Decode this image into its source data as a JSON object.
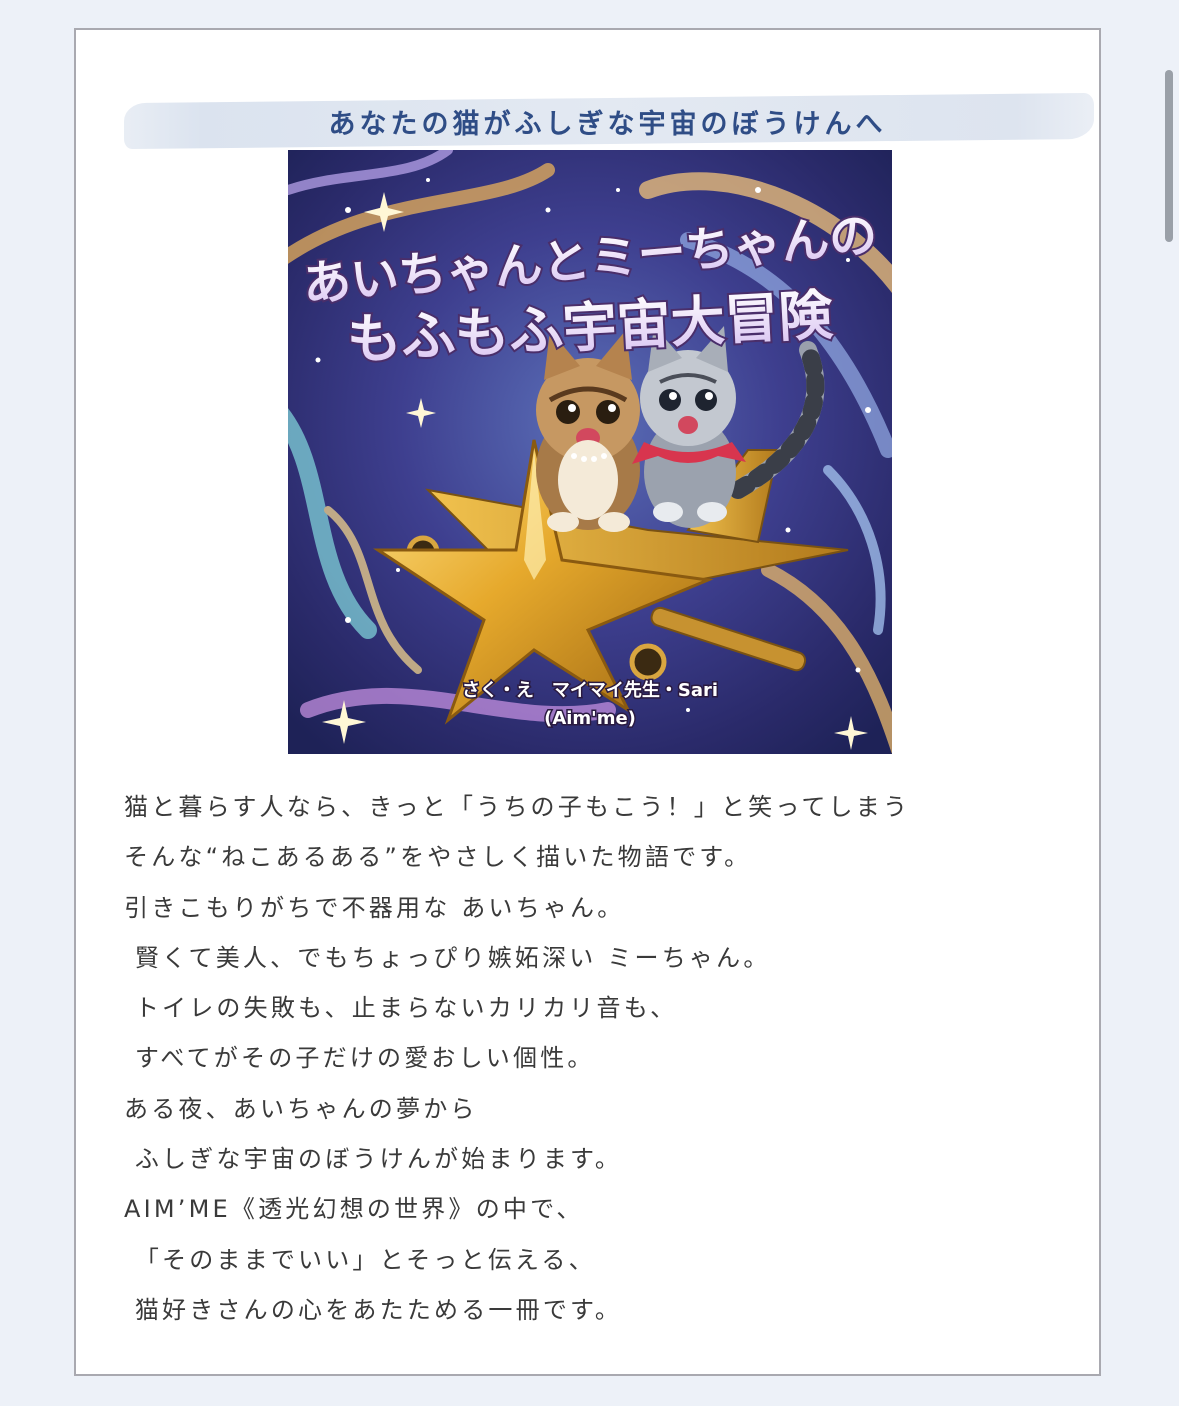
{
  "heading": "あなたの猫がふしぎな宇宙のぼうけんへ",
  "cover": {
    "title_line1": "あいちゃんとミーちゃんの",
    "title_line2": "もふもふ宇宙大冒険",
    "credit_line1": "さく・え　マイマイ先生・Sari",
    "credit_line2": "(Aim'me)"
  },
  "description": [
    "猫と暮らす人なら、きっと「うちの子もこう！」と笑ってしまう",
    "そんな“ねこあるある”をやさしく描いた物語です。",
    "引きこもりがちで不器用な あいちゃん。",
    " 賢くて美人、でもちょっぴり嫉妬深い ミーちゃん。",
    " トイレの失敗も、止まらないカリカリ音も、",
    " すべてがその子だけの愛おしい個性。",
    "ある夜、あいちゃんの夢から",
    " ふしぎな宇宙のぼうけんが始まります。",
    "AIM’ME《透光幻想の世界》の中で、",
    " 「そのままでいい」とそっと伝える、",
    " 猫好きさんの心をあたためる一冊です。"
  ],
  "colors": {
    "heading": "#2f4d86",
    "body_text": "#3a3a3a",
    "page_bg": "#edf1f8",
    "card_border": "#a9a9b0"
  }
}
